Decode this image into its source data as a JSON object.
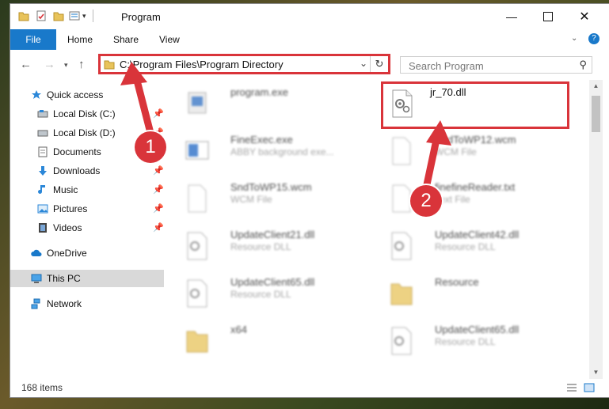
{
  "window": {
    "title": "Program"
  },
  "ribbon": {
    "tabs": [
      "File",
      "Home",
      "Share",
      "View"
    ]
  },
  "address": {
    "path": "C:\\Program Files\\Program Directory"
  },
  "search": {
    "placeholder": "Search Program"
  },
  "nav": {
    "items": [
      {
        "label": "Quick access",
        "pinned": false
      },
      {
        "label": "Local Disk (C:)",
        "pinned": true
      },
      {
        "label": "Local Disk (D:)",
        "pinned": true
      },
      {
        "label": "Documents",
        "pinned": true
      },
      {
        "label": "Downloads",
        "pinned": true
      },
      {
        "label": "Music",
        "pinned": true
      },
      {
        "label": "Pictures",
        "pinned": true
      },
      {
        "label": "Videos",
        "pinned": true
      },
      {
        "label": "OneDrive",
        "pinned": false
      },
      {
        "label": "This PC",
        "pinned": false,
        "selected": true
      },
      {
        "label": "Network",
        "pinned": false
      }
    ]
  },
  "files": [
    {
      "name": "program.exe",
      "type": "",
      "icon": "exe-icon"
    },
    {
      "name": "jr_70.dll",
      "type": "",
      "icon": "dll-gear-icon"
    },
    {
      "name": "FineExec.exe",
      "type": "ABBY background exe...",
      "icon": "app-icon"
    },
    {
      "name": "SndToWP12.wcm",
      "type": "WCM File",
      "icon": "file-icon"
    },
    {
      "name": "SndToWP15.wcm",
      "type": "WCM File",
      "icon": "file-icon"
    },
    {
      "name": "finefineReader.txt",
      "type": "Text File",
      "icon": "file-icon"
    },
    {
      "name": "UpdateClient21.dll",
      "type": "Resource DLL",
      "icon": "dll-gear-icon"
    },
    {
      "name": "UpdateClient42.dll",
      "type": "Resource DLL",
      "icon": "dll-gear-icon"
    },
    {
      "name": "UpdateClient65.dll",
      "type": "Resource DLL",
      "icon": "dll-gear-icon"
    },
    {
      "name": "Resource",
      "type": "",
      "icon": "folder-icon"
    },
    {
      "name": "x64",
      "type": "",
      "icon": "folder-icon"
    },
    {
      "name": "UpdateClient65.dll",
      "type": "Resource DLL",
      "icon": "dll-gear-icon"
    }
  ],
  "status": {
    "count": "168 items"
  },
  "callouts": {
    "one": "1",
    "two": "2"
  },
  "colors": {
    "accent": "#1979ca",
    "highlight": "#d9343a"
  }
}
